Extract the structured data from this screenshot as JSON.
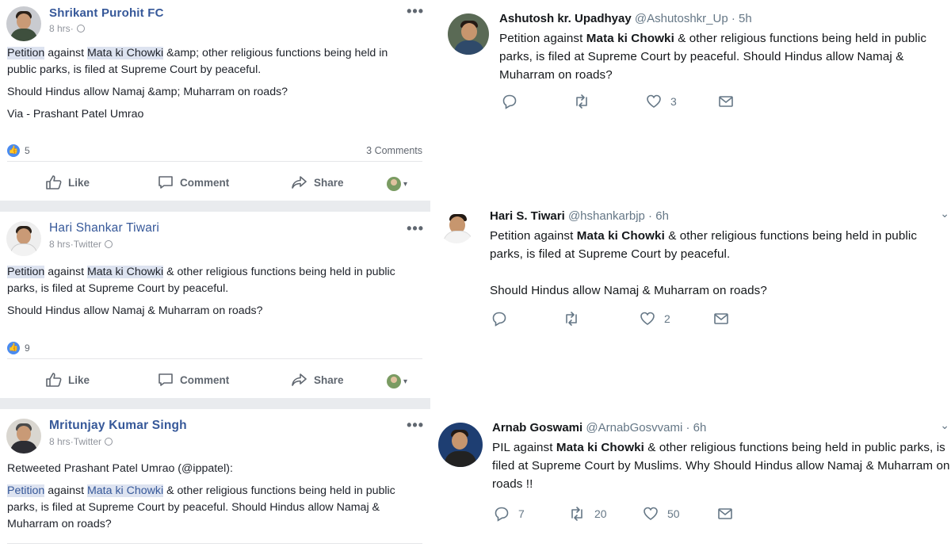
{
  "facebook_posts": [
    {
      "author": "Shrikant Purohit FC",
      "time": "8 hrs",
      "source": "",
      "text1_a": "Petition",
      "text1_b": " against ",
      "text1_c": "Mata ki Chowki",
      "text1_d": " &amp; other religious functions being held in public parks, is filed at Supreme Court by peaceful.",
      "text2": "Should Hindus allow Namaj &amp; Muharram on roads?",
      "text3": "Via - Prashant Patel Umrao",
      "reactions": "5",
      "comments": "3 Comments"
    },
    {
      "author": "Hari Shankar Tiwari",
      "time": "8 hrs",
      "source": "Twitter",
      "text1_a": "Petition",
      "text1_b": " against ",
      "text1_c": "Mata ki Chowki",
      "text1_d": " & other religious functions being held in public parks, is filed at Supreme Court by peaceful.",
      "text2": "Should Hindus allow Namaj & Muharram on roads?",
      "reactions": "9"
    },
    {
      "author": "Mritunjay Kumar Singh",
      "time": "8 hrs",
      "source": "Twitter",
      "retweet_line": "Retweeted Prashant Patel Umrao (@ippatel):",
      "text1_a": "Petition",
      "text1_b": " against ",
      "text1_c": "Mata ki Chowki",
      "text1_d": " & other religious functions being held in public parks, is filed at Supreme Court by peaceful. Should Hindus allow Namaj & Muharram on roads?"
    }
  ],
  "fb_actions": {
    "like": "Like",
    "comment": "Comment",
    "share": "Share"
  },
  "tweets": [
    {
      "name": "Ashutosh kr. Upadhyay",
      "handle": "@Ashutoshkr_Up",
      "time": "5h",
      "pre": "Petition against ",
      "bold": "Mata ki Chowki",
      "post": " & other religious functions being held in public parks, is filed at Supreme Court by peaceful. Should Hindus allow Namaj & Muharram on roads?",
      "replies": "",
      "retweets": "",
      "likes": "3"
    },
    {
      "name": "Hari S. Tiwari",
      "handle": "@hshankarbjp",
      "time": "6h",
      "pre": "Petition against ",
      "bold": "Mata ki Chowki",
      "post": " & other religious functions being held in public parks, is filed at Supreme Court by peaceful.",
      "extra": "Should Hindus allow Namaj & Muharram on roads?",
      "replies": "",
      "retweets": "",
      "likes": "2"
    },
    {
      "name": "Arnab Goswami",
      "handle": "@ArnabGosvvami",
      "time": "6h",
      "pre": "PIL against ",
      "bold": "Mata ki Chowki",
      "post": " & other religious functions being held in public parks, is filed at Supreme Court by Muslims. Why Should Hindus allow Namaj & Muharram on roads !!",
      "replies": "7",
      "retweets": "20",
      "likes": "50"
    }
  ],
  "ui": {
    "dots": "•••",
    "dot_sep": " · ",
    "caret": "▾",
    "chevron": "⌄"
  }
}
